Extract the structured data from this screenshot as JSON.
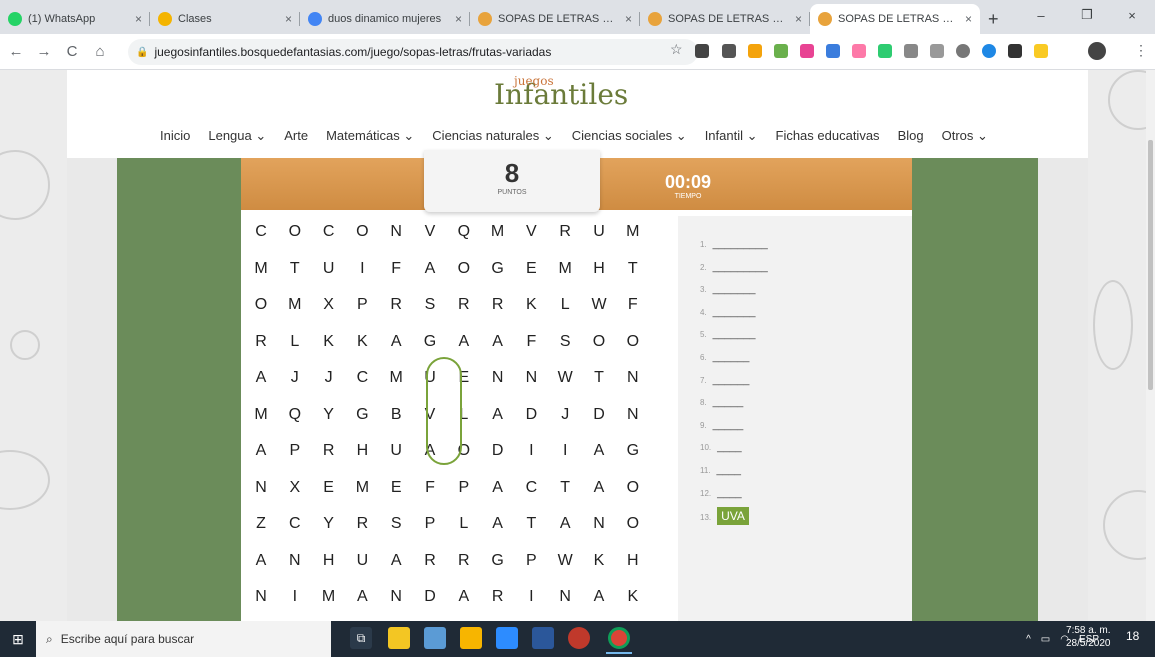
{
  "tabs": [
    {
      "title": "(1) WhatsApp",
      "icon": "whatsapp-icon",
      "color": "#25d366"
    },
    {
      "title": "Clases",
      "icon": "classroom-icon",
      "color": "#f4b400"
    },
    {
      "title": "duos dinamico mujeres",
      "icon": "google-icon",
      "color": "#4285f4"
    },
    {
      "title": "SOPAS DE LETRAS ® D",
      "icon": "pencil-icon",
      "color": "#e8a33c"
    },
    {
      "title": "SOPAS DE LETRAS ® D",
      "icon": "pencil-icon",
      "color": "#e8a33c"
    },
    {
      "title": "SOPAS DE LETRAS DE F",
      "icon": "pencil-icon",
      "color": "#e8a33c"
    }
  ],
  "close_glyph": "×",
  "newtab_glyph": "+",
  "window_controls": {
    "minimize": "–",
    "restore": "❐",
    "close": "×"
  },
  "address": {
    "url": "juegosinfantiles.bosquedefantasias.com/juego/sopas-letras/frutas-variadas",
    "back": "←",
    "forward": "→",
    "reload": "C",
    "home": "⌂",
    "star": "☆",
    "menu": "⋮"
  },
  "site": {
    "logo_top": "juegos",
    "logo_main": "Infantiles",
    "nav": [
      "Inicio",
      "Lengua ⌄",
      "Arte",
      "Matemáticas ⌄",
      "Ciencias naturales ⌄",
      "Ciencias sociales ⌄",
      "Infantil ⌄",
      "Fichas educativas",
      "Blog",
      "Otros ⌄"
    ]
  },
  "game": {
    "score": "8",
    "score_label": "PUNTOS",
    "timer": "00:09",
    "timer_label": "TIEMPO",
    "grid": [
      [
        "C",
        "O",
        "C",
        "O",
        "N",
        "V",
        "Q",
        "M",
        "V",
        "R",
        "U",
        "M"
      ],
      [
        "M",
        "T",
        "U",
        "I",
        "F",
        "A",
        "O",
        "G",
        "E",
        "M",
        "H",
        "T"
      ],
      [
        "O",
        "M",
        "X",
        "P",
        "R",
        "S",
        "R",
        "R",
        "K",
        "L",
        "W",
        "F"
      ],
      [
        "R",
        "L",
        "K",
        "K",
        "A",
        "G",
        "A",
        "A",
        "F",
        "S",
        "O",
        "O"
      ],
      [
        "A",
        "J",
        "J",
        "C",
        "M",
        "U",
        "E",
        "N",
        "N",
        "W",
        "T",
        "N"
      ],
      [
        "M",
        "Q",
        "Y",
        "G",
        "B",
        "V",
        "L",
        "A",
        "D",
        "J",
        "D",
        "N"
      ],
      [
        "A",
        "P",
        "R",
        "H",
        "U",
        "A",
        "O",
        "D",
        "I",
        "I",
        "A",
        "G"
      ],
      [
        "N",
        "X",
        "E",
        "M",
        "E",
        "F",
        "P",
        "A",
        "C",
        "T",
        "A",
        "O"
      ],
      [
        "Z",
        "C",
        "Y",
        "R",
        "S",
        "P",
        "L",
        "A",
        "T",
        "A",
        "N",
        "O"
      ],
      [
        "A",
        "N",
        "H",
        "U",
        "A",
        "R",
        "R",
        "G",
        "P",
        "W",
        "K",
        "H"
      ],
      [
        "N",
        "I",
        "M",
        "A",
        "N",
        "D",
        "A",
        "R",
        "I",
        "N",
        "A",
        "K"
      ]
    ],
    "words": [
      {
        "num": "1.",
        "text": "_________",
        "found": false
      },
      {
        "num": "2.",
        "text": "_________",
        "found": false
      },
      {
        "num": "3.",
        "text": "_______",
        "found": false
      },
      {
        "num": "4.",
        "text": "_______",
        "found": false
      },
      {
        "num": "5.",
        "text": "_______",
        "found": false
      },
      {
        "num": "6.",
        "text": "______",
        "found": false
      },
      {
        "num": "7.",
        "text": "______",
        "found": false
      },
      {
        "num": "8.",
        "text": "_____",
        "found": false
      },
      {
        "num": "9.",
        "text": "_____",
        "found": false
      },
      {
        "num": "10.",
        "text": "____",
        "found": false
      },
      {
        "num": "11.",
        "text": "____",
        "found": false
      },
      {
        "num": "12.",
        "text": "____",
        "found": false
      },
      {
        "num": "13.",
        "text": "UVA",
        "found": true
      }
    ],
    "accent_green": "#7aa33a",
    "band_orange": "#dc9850"
  },
  "taskbar": {
    "search_placeholder": "Escribe aquí para buscar",
    "lang": "ESP",
    "time": "7:58 a. m.",
    "date": "28/5/2020",
    "notifications": "18"
  }
}
